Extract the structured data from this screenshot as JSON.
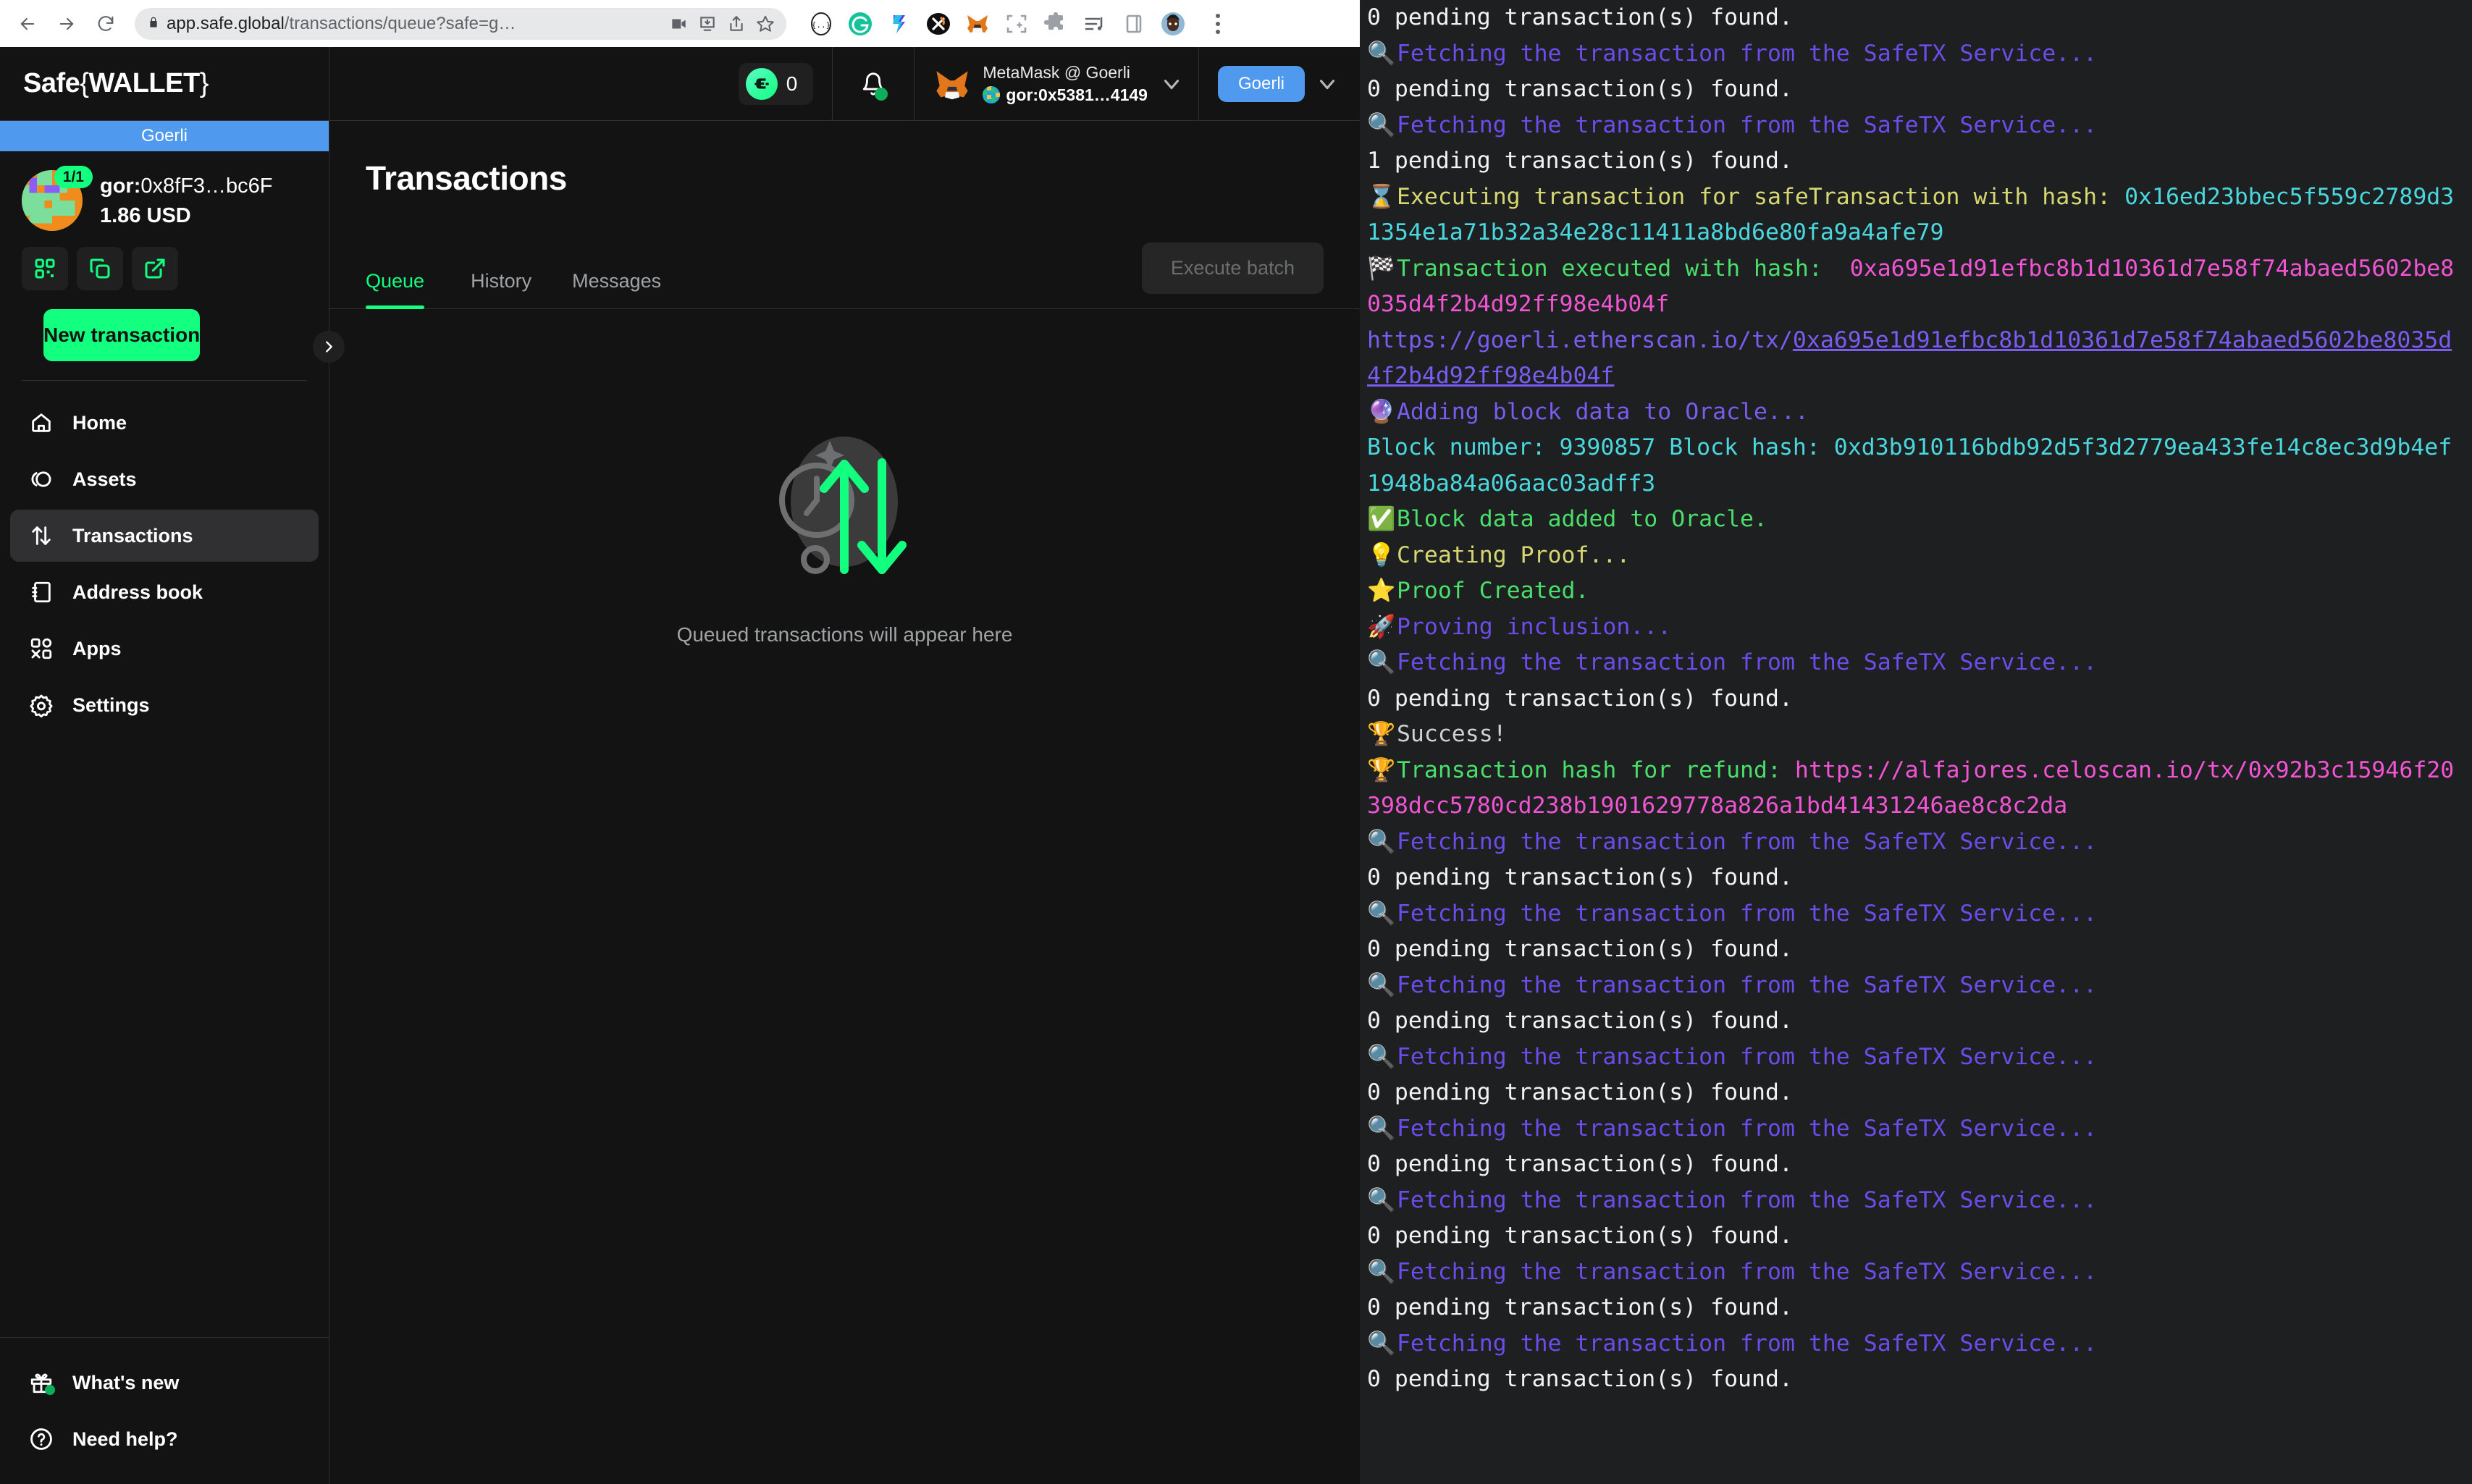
{
  "browser": {
    "url_host": "app.safe.global",
    "url_path": "/transactions/queue?safe=g…",
    "back_icon": "back-arrow-icon",
    "forward_icon": "forward-arrow-icon",
    "reload_icon": "reload-icon",
    "lock_icon": "lock-icon",
    "omnibox_icons": [
      "video-camera-icon",
      "install-app-icon",
      "share-icon",
      "bookmark-star-icon"
    ],
    "extensions": [
      "brackets-icon",
      "grammarly-icon",
      "tally-icon",
      "xdefi-icon",
      "metamask-fox-icon",
      "screenshot-icon",
      "puzzle-extensions-icon",
      "playlist-icon",
      "sidebar-icon"
    ],
    "profile_icon": "user-avatar-icon",
    "menu_icon": "kebab-menu-icon"
  },
  "header": {
    "brand": "Safe",
    "brand_bracket_left": "{",
    "brand_wallet": "WALLET",
    "brand_bracket_right": "}",
    "tx_counter": "0",
    "tx_counter_icon": "safe-logo-icon",
    "bell_icon": "notification-bell-icon",
    "wallet_name": "MetaMask @ Goerli",
    "wallet_address": "gor:0x5381…4149",
    "wallet_chevron_icon": "chevron-down-icon",
    "network_chip": "Goerli",
    "network_chevron_icon": "chevron-down-icon"
  },
  "sidebar": {
    "network_banner": "Goerli",
    "threshold": "1/1",
    "safe_address_prefix": "gor:",
    "safe_address": "0x8fF3…bc6F",
    "safe_balance": "1.86 USD",
    "action_icons": [
      "qr-code-icon",
      "copy-icon",
      "external-link-icon"
    ],
    "new_transaction": "New transaction",
    "items": [
      {
        "label": "Home",
        "icon": "home-icon",
        "active": false
      },
      {
        "label": "Assets",
        "icon": "coins-icon",
        "active": false
      },
      {
        "label": "Transactions",
        "icon": "arrows-up-down-icon",
        "active": true
      },
      {
        "label": "Address book",
        "icon": "address-book-icon",
        "active": false
      },
      {
        "label": "Apps",
        "icon": "apps-grid-icon",
        "active": false
      },
      {
        "label": "Settings",
        "icon": "gear-icon",
        "active": false
      }
    ],
    "bottom_items": [
      {
        "label": "What's new",
        "icon": "gift-icon"
      },
      {
        "label": "Need help?",
        "icon": "question-circle-icon"
      }
    ],
    "expander_icon": "chevron-right-icon"
  },
  "main": {
    "page_title": "Transactions",
    "tabs": [
      {
        "label": "Queue",
        "active": true
      },
      {
        "label": "History",
        "active": false
      },
      {
        "label": "Messages",
        "active": false
      }
    ],
    "execute_batch": "Execute batch",
    "empty_icon": "clock-arrows-icon",
    "empty_text": "Queued transactions will appear here"
  },
  "terminal": {
    "lines": [
      {
        "icon": "",
        "segments": [
          {
            "text": "0 pending transaction(s) found.",
            "color": "c-white"
          }
        ]
      },
      {
        "icon": "🔍",
        "segments": [
          {
            "text": "Fetching the transaction from the SafeTX Service...",
            "color": "c-purple"
          }
        ]
      },
      {
        "icon": "",
        "segments": [
          {
            "text": "0 pending transaction(s) found.",
            "color": "c-white"
          }
        ]
      },
      {
        "icon": "🔍",
        "segments": [
          {
            "text": "Fetching the transaction from the SafeTX Service...",
            "color": "c-purple"
          }
        ]
      },
      {
        "icon": "",
        "segments": [
          {
            "text": "1 pending transaction(s) found.",
            "color": "c-white"
          }
        ]
      },
      {
        "icon": "⌛",
        "segments": [
          {
            "text": "Executing transaction for safeTransaction with hash: ",
            "color": "c-yellow"
          },
          {
            "text": "0x16ed23bbec5f559c2789d31354e1a71b32a34e28c11411a8bd6e80fa9a4afe79",
            "color": "c-cyan"
          }
        ]
      },
      {
        "icon": "🏁",
        "segments": [
          {
            "text": "Transaction executed with hash:  ",
            "color": "c-green"
          },
          {
            "text": "0xa695e1d91efbc8b1d10361d7e58f74abaed5602be8035d4f2b4d92ff98e4b04f",
            "color": "c-magenta"
          }
        ]
      },
      {
        "icon": "",
        "segments": [
          {
            "text": "https://goerli.etherscan.io/tx/",
            "color": "c-blue"
          },
          {
            "text": "0xa695e1d91efbc8b1d10361d7e58f74abaed5602be8035d4f2b4d92ff98e4b04f",
            "color": "c-blue",
            "underline": true
          }
        ]
      },
      {
        "icon": "🔮",
        "segments": [
          {
            "text": "Adding block data to Oracle...",
            "color": "c-blue"
          }
        ]
      },
      {
        "icon": "",
        "segments": [
          {
            "text": "Block number: 9390857 Block hash: 0xd3b910116bdb92d5f3d2779ea433fe14c8ec3d9b4ef1948ba84a06aac03adff3",
            "color": "c-cyan"
          }
        ]
      },
      {
        "icon": "✅",
        "segments": [
          {
            "text": "Block data added to Oracle.",
            "color": "c-green"
          }
        ]
      },
      {
        "icon": "💡",
        "segments": [
          {
            "text": "Creating Proof...",
            "color": "c-yellow"
          }
        ]
      },
      {
        "icon": "⭐",
        "segments": [
          {
            "text": "Proof Created.",
            "color": "c-green"
          }
        ]
      },
      {
        "icon": "🚀",
        "segments": [
          {
            "text": "Proving inclusion...",
            "color": "c-purple"
          }
        ]
      },
      {
        "icon": "🔍",
        "segments": [
          {
            "text": "Fetching the transaction from the SafeTX Service...",
            "color": "c-purple"
          }
        ]
      },
      {
        "icon": "",
        "segments": [
          {
            "text": "0 pending transaction(s) found.",
            "color": "c-white"
          }
        ]
      },
      {
        "icon": "🏆",
        "segments": [
          {
            "text": "Success!",
            "color": "c-gray"
          }
        ]
      },
      {
        "icon": "🏆",
        "segments": [
          {
            "text": "Transaction hash for refund: ",
            "color": "c-green"
          },
          {
            "text": "https://alfajores.celoscan.io/tx/0x92b3c15946f20398dcc5780cd238b1901629778a826a1bd41431246ae8c8c2da",
            "color": "c-pink"
          }
        ]
      },
      {
        "icon": "🔍",
        "segments": [
          {
            "text": "Fetching the transaction from the SafeTX Service...",
            "color": "c-purple"
          }
        ]
      },
      {
        "icon": "",
        "segments": [
          {
            "text": "0 pending transaction(s) found.",
            "color": "c-white"
          }
        ]
      },
      {
        "icon": "🔍",
        "segments": [
          {
            "text": "Fetching the transaction from the SafeTX Service...",
            "color": "c-purple"
          }
        ]
      },
      {
        "icon": "",
        "segments": [
          {
            "text": "0 pending transaction(s) found.",
            "color": "c-white"
          }
        ]
      },
      {
        "icon": "🔍",
        "segments": [
          {
            "text": "Fetching the transaction from the SafeTX Service...",
            "color": "c-purple"
          }
        ]
      },
      {
        "icon": "",
        "segments": [
          {
            "text": "0 pending transaction(s) found.",
            "color": "c-white"
          }
        ]
      },
      {
        "icon": "🔍",
        "segments": [
          {
            "text": "Fetching the transaction from the SafeTX Service...",
            "color": "c-purple"
          }
        ]
      },
      {
        "icon": "",
        "segments": [
          {
            "text": "0 pending transaction(s) found.",
            "color": "c-white"
          }
        ]
      },
      {
        "icon": "🔍",
        "segments": [
          {
            "text": "Fetching the transaction from the SafeTX Service...",
            "color": "c-purple"
          }
        ]
      },
      {
        "icon": "",
        "segments": [
          {
            "text": "0 pending transaction(s) found.",
            "color": "c-white"
          }
        ]
      },
      {
        "icon": "🔍",
        "segments": [
          {
            "text": "Fetching the transaction from the SafeTX Service...",
            "color": "c-purple"
          }
        ]
      },
      {
        "icon": "",
        "segments": [
          {
            "text": "0 pending transaction(s) found.",
            "color": "c-white"
          }
        ]
      },
      {
        "icon": "🔍",
        "segments": [
          {
            "text": "Fetching the transaction from the SafeTX Service...",
            "color": "c-purple"
          }
        ]
      },
      {
        "icon": "",
        "segments": [
          {
            "text": "0 pending transaction(s) found.",
            "color": "c-white"
          }
        ]
      },
      {
        "icon": "🔍",
        "segments": [
          {
            "text": "Fetching the transaction from the SafeTX Service...",
            "color": "c-purple"
          }
        ]
      },
      {
        "icon": "",
        "segments": [
          {
            "text": "0 pending transaction(s) found.",
            "color": "c-white"
          }
        ]
      }
    ]
  },
  "colors": {
    "accent_green": "#12ff80",
    "network_blue": "#4f9aee",
    "app_bg": "#121312",
    "terminal_bg": "#1d1f21"
  }
}
